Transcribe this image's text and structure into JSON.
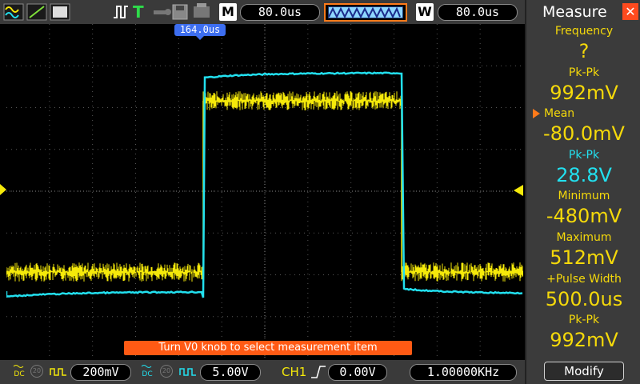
{
  "topbar": {
    "run_icon": "waveform-icon",
    "trigger_mode_label": "T",
    "memory_label": "M",
    "memory_depth": "80.0us",
    "window_label": "W",
    "window_time": "80.0us"
  },
  "screen": {
    "trigger_position": "164.0us",
    "hint": "Turn V0 knob to select measurement item"
  },
  "bottombar": {
    "ch1": {
      "coupling": "DC",
      "bw": "20",
      "scale": "200mV",
      "color": "#f5e90a"
    },
    "ch2": {
      "coupling": "DC",
      "bw": "20",
      "scale": "5.00V",
      "color": "#22e0ef"
    },
    "trigger": {
      "source": "CH1",
      "level": "0.00V"
    },
    "frequency": "1.00000KHz"
  },
  "panel": {
    "title": "Measure",
    "items": [
      {
        "label": "Frequency",
        "value": "?",
        "color": "yellow"
      },
      {
        "label": "Pk-Pk",
        "value": "992mV",
        "color": "yellow"
      },
      {
        "label": "Mean",
        "value": "-80.0mV",
        "color": "yellow",
        "selected": true
      },
      {
        "label": "Pk-Pk",
        "value": "28.8V",
        "color": "cyan"
      },
      {
        "label": "Minimum",
        "value": "-480mV",
        "color": "yellow"
      },
      {
        "label": "Maximum",
        "value": "512mV",
        "color": "yellow"
      },
      {
        "label": "+Pulse Width",
        "value": "500.0us",
        "color": "yellow"
      },
      {
        "label": "Pk-Pk",
        "value": "992mV",
        "color": "yellow"
      }
    ],
    "modify_label": "Modify"
  },
  "colors": {
    "ch1": "#f5e90a",
    "ch2": "#22e0ef",
    "accent": "#ff5a14",
    "trigger_marker": "#3d6ef0"
  }
}
